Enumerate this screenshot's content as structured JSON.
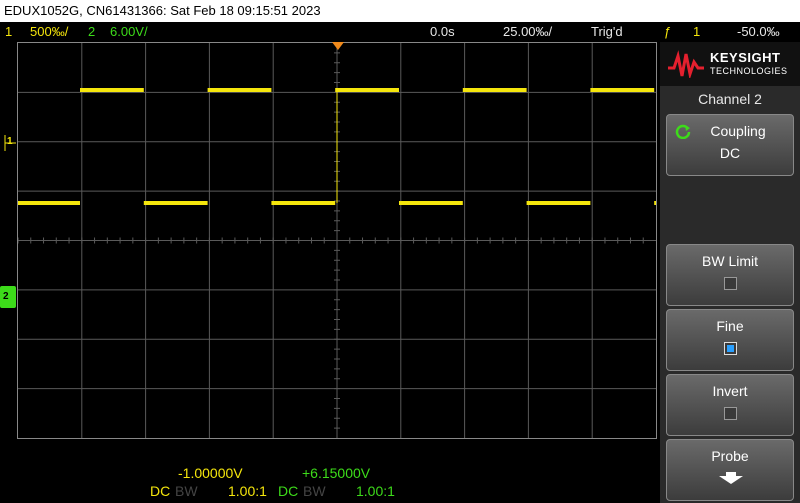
{
  "titlebar": {
    "text": "EDUX1052G, CN61431366: Sat Feb 18 09:15:51 2023"
  },
  "status": {
    "ch1_num": "1",
    "ch1_scale": "500‰/",
    "ch2_num": "2",
    "ch2_scale": "6.00V/",
    "time_delay": "0.0s",
    "time_scale": "25.00‰/",
    "trig_state": "Trig'd",
    "trig_source": "1",
    "trig_level": "-50.0‰"
  },
  "brand": {
    "line1": "KEYSIGHT",
    "line2": "TECHNOLOGIES"
  },
  "menu": {
    "title": "Channel 2",
    "softkeys": [
      {
        "label": "Coupling",
        "value": "DC"
      },
      {
        "label": "BW Limit",
        "checked": false
      },
      {
        "label": "Fine",
        "checked": true
      },
      {
        "label": "Invert",
        "checked": false
      },
      {
        "label": "Probe"
      }
    ]
  },
  "markers": {
    "ch1": "1",
    "ch2": "2"
  },
  "bottom": {
    "ch1_offset": "-1.00000V",
    "ch2_offset": "+6.15000V",
    "ch1_coupling": "DC",
    "ch1_bw": "BW",
    "ch1_probe": "1.00:1",
    "ch2_coupling": "DC",
    "ch2_bw": "BW",
    "ch2_probe": "1.00:1"
  },
  "colors": {
    "ch1": "#f5e60c",
    "ch2": "#3ddb1a",
    "grid": "#5a5a5a",
    "fine_checkbox": "#2aa0ff"
  },
  "waveforms": {
    "ch1": {
      "type": "square",
      "period_divisions": 2,
      "high_division": 6.5,
      "low_division": 3.5
    },
    "ch2": {
      "type": "rc_charge_discharge",
      "period_divisions": 2
    }
  }
}
